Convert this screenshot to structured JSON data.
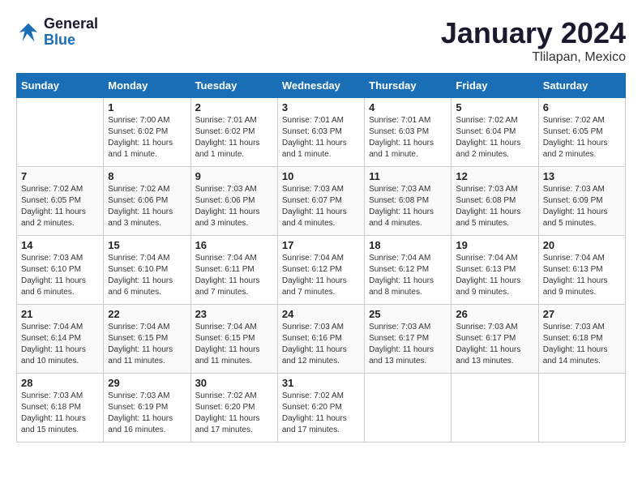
{
  "header": {
    "logo_general": "General",
    "logo_blue": "Blue",
    "month_title": "January 2024",
    "location": "Tlilapan, Mexico"
  },
  "days_of_week": [
    "Sunday",
    "Monday",
    "Tuesday",
    "Wednesday",
    "Thursday",
    "Friday",
    "Saturday"
  ],
  "weeks": [
    [
      {
        "day": "",
        "info": ""
      },
      {
        "day": "1",
        "info": "Sunrise: 7:00 AM\nSunset: 6:02 PM\nDaylight: 11 hours\nand 1 minute."
      },
      {
        "day": "2",
        "info": "Sunrise: 7:01 AM\nSunset: 6:02 PM\nDaylight: 11 hours\nand 1 minute."
      },
      {
        "day": "3",
        "info": "Sunrise: 7:01 AM\nSunset: 6:03 PM\nDaylight: 11 hours\nand 1 minute."
      },
      {
        "day": "4",
        "info": "Sunrise: 7:01 AM\nSunset: 6:03 PM\nDaylight: 11 hours\nand 1 minute."
      },
      {
        "day": "5",
        "info": "Sunrise: 7:02 AM\nSunset: 6:04 PM\nDaylight: 11 hours\nand 2 minutes."
      },
      {
        "day": "6",
        "info": "Sunrise: 7:02 AM\nSunset: 6:05 PM\nDaylight: 11 hours\nand 2 minutes."
      }
    ],
    [
      {
        "day": "7",
        "info": "Sunrise: 7:02 AM\nSunset: 6:05 PM\nDaylight: 11 hours\nand 2 minutes."
      },
      {
        "day": "8",
        "info": "Sunrise: 7:02 AM\nSunset: 6:06 PM\nDaylight: 11 hours\nand 3 minutes."
      },
      {
        "day": "9",
        "info": "Sunrise: 7:03 AM\nSunset: 6:06 PM\nDaylight: 11 hours\nand 3 minutes."
      },
      {
        "day": "10",
        "info": "Sunrise: 7:03 AM\nSunset: 6:07 PM\nDaylight: 11 hours\nand 4 minutes."
      },
      {
        "day": "11",
        "info": "Sunrise: 7:03 AM\nSunset: 6:08 PM\nDaylight: 11 hours\nand 4 minutes."
      },
      {
        "day": "12",
        "info": "Sunrise: 7:03 AM\nSunset: 6:08 PM\nDaylight: 11 hours\nand 5 minutes."
      },
      {
        "day": "13",
        "info": "Sunrise: 7:03 AM\nSunset: 6:09 PM\nDaylight: 11 hours\nand 5 minutes."
      }
    ],
    [
      {
        "day": "14",
        "info": "Sunrise: 7:03 AM\nSunset: 6:10 PM\nDaylight: 11 hours\nand 6 minutes."
      },
      {
        "day": "15",
        "info": "Sunrise: 7:04 AM\nSunset: 6:10 PM\nDaylight: 11 hours\nand 6 minutes."
      },
      {
        "day": "16",
        "info": "Sunrise: 7:04 AM\nSunset: 6:11 PM\nDaylight: 11 hours\nand 7 minutes."
      },
      {
        "day": "17",
        "info": "Sunrise: 7:04 AM\nSunset: 6:12 PM\nDaylight: 11 hours\nand 7 minutes."
      },
      {
        "day": "18",
        "info": "Sunrise: 7:04 AM\nSunset: 6:12 PM\nDaylight: 11 hours\nand 8 minutes."
      },
      {
        "day": "19",
        "info": "Sunrise: 7:04 AM\nSunset: 6:13 PM\nDaylight: 11 hours\nand 9 minutes."
      },
      {
        "day": "20",
        "info": "Sunrise: 7:04 AM\nSunset: 6:13 PM\nDaylight: 11 hours\nand 9 minutes."
      }
    ],
    [
      {
        "day": "21",
        "info": "Sunrise: 7:04 AM\nSunset: 6:14 PM\nDaylight: 11 hours\nand 10 minutes."
      },
      {
        "day": "22",
        "info": "Sunrise: 7:04 AM\nSunset: 6:15 PM\nDaylight: 11 hours\nand 11 minutes."
      },
      {
        "day": "23",
        "info": "Sunrise: 7:04 AM\nSunset: 6:15 PM\nDaylight: 11 hours\nand 11 minutes."
      },
      {
        "day": "24",
        "info": "Sunrise: 7:03 AM\nSunset: 6:16 PM\nDaylight: 11 hours\nand 12 minutes."
      },
      {
        "day": "25",
        "info": "Sunrise: 7:03 AM\nSunset: 6:17 PM\nDaylight: 11 hours\nand 13 minutes."
      },
      {
        "day": "26",
        "info": "Sunrise: 7:03 AM\nSunset: 6:17 PM\nDaylight: 11 hours\nand 13 minutes."
      },
      {
        "day": "27",
        "info": "Sunrise: 7:03 AM\nSunset: 6:18 PM\nDaylight: 11 hours\nand 14 minutes."
      }
    ],
    [
      {
        "day": "28",
        "info": "Sunrise: 7:03 AM\nSunset: 6:18 PM\nDaylight: 11 hours\nand 15 minutes."
      },
      {
        "day": "29",
        "info": "Sunrise: 7:03 AM\nSunset: 6:19 PM\nDaylight: 11 hours\nand 16 minutes."
      },
      {
        "day": "30",
        "info": "Sunrise: 7:02 AM\nSunset: 6:20 PM\nDaylight: 11 hours\nand 17 minutes."
      },
      {
        "day": "31",
        "info": "Sunrise: 7:02 AM\nSunset: 6:20 PM\nDaylight: 11 hours\nand 17 minutes."
      },
      {
        "day": "",
        "info": ""
      },
      {
        "day": "",
        "info": ""
      },
      {
        "day": "",
        "info": ""
      }
    ]
  ]
}
